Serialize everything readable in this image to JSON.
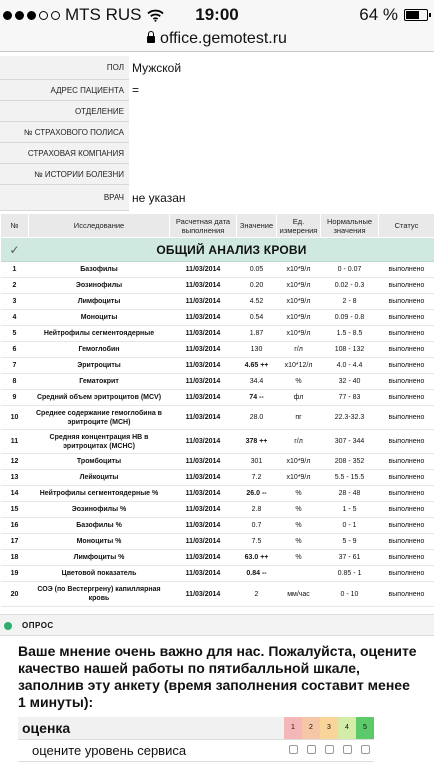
{
  "status_bar": {
    "carrier": "MTS RUS",
    "time": "19:00",
    "battery": "64 %",
    "battery_level": 0.64
  },
  "url_bar": {
    "domain": "office.gemotest.ru"
  },
  "patient": [
    {
      "label": "ПОЛ",
      "value": "Мужской"
    },
    {
      "label": "АДРЕС ПАЦИЕНТА",
      "value": "="
    },
    {
      "label": "ОТДЕЛЕНИЕ",
      "value": ""
    },
    {
      "label": "№ СТРАХОВОГО ПОЛИСА",
      "value": ""
    },
    {
      "label": "СТРАХОВАЯ КОМПАНИЯ",
      "value": ""
    },
    {
      "label": "№ ИСТОРИИ БОЛЕЗНИ",
      "value": ""
    },
    {
      "label": "ВРАЧ",
      "value": "не указан"
    }
  ],
  "table": {
    "headers": [
      "№",
      "Исследование",
      "Расчетная дата выполнения",
      "Значение",
      "Ед. измерения",
      "Нормальные значения",
      "Статус"
    ],
    "section_title": "ОБЩИЙ АНАЛИЗ КРОВИ",
    "section_check": "✓",
    "rows": [
      {
        "num": "1",
        "name": "Базофилы",
        "date": "11/03/2014",
        "value": "0.05",
        "unit": "x10*9/л",
        "norm": "0 - 0.07",
        "status": "выполнено",
        "flag": false
      },
      {
        "num": "2",
        "name": "Эозинофилы",
        "date": "11/03/2014",
        "value": "0.20",
        "unit": "x10*9/л",
        "norm": "0.02 - 0.3",
        "status": "выполнено",
        "flag": false
      },
      {
        "num": "3",
        "name": "Лимфоциты",
        "date": "11/03/2014",
        "value": "4.52",
        "unit": "x10*9/л",
        "norm": "2 - 8",
        "status": "выполнено",
        "flag": false
      },
      {
        "num": "4",
        "name": "Моноциты",
        "date": "11/03/2014",
        "value": "0.54",
        "unit": "x10*9/л",
        "norm": "0.09 - 0.8",
        "status": "выполнено",
        "flag": false
      },
      {
        "num": "5",
        "name": "Нейтрофилы сегментоядерные",
        "date": "11/03/2014",
        "value": "1.87",
        "unit": "x10*9/л",
        "norm": "1.5 - 8.5",
        "status": "выполнено",
        "flag": false
      },
      {
        "num": "6",
        "name": "Гемоглобин",
        "date": "11/03/2014",
        "value": "130",
        "unit": "г/л",
        "norm": "108 - 132",
        "status": "выполнено",
        "flag": false
      },
      {
        "num": "7",
        "name": "Эритроциты",
        "date": "11/03/2014",
        "value": "4.65 ++",
        "unit": "x10*12/л",
        "norm": "4.0 - 4.4",
        "status": "выполнено",
        "flag": true
      },
      {
        "num": "8",
        "name": "Гематокрит",
        "date": "11/03/2014",
        "value": "34.4",
        "unit": "%",
        "norm": "32 - 40",
        "status": "выполнено",
        "flag": false
      },
      {
        "num": "9",
        "name": "Средний объем эритроцитов (MCV)",
        "date": "11/03/2014",
        "value": "74 --",
        "unit": "фл",
        "norm": "77 - 83",
        "status": "выполнено",
        "flag": true
      },
      {
        "num": "10",
        "name": "Среднее содержание гемоглобина в эритроците (МСН)",
        "date": "11/03/2014",
        "value": "28.0",
        "unit": "пг",
        "norm": "22.3-32.3",
        "status": "выполнено",
        "flag": false
      },
      {
        "num": "11",
        "name": "Средняя концентрация НВ в эритроцитах (МСНС)",
        "date": "11/03/2014",
        "value": "378 ++",
        "unit": "г/л",
        "norm": "307 - 344",
        "status": "выполнено",
        "flag": true
      },
      {
        "num": "12",
        "name": "Тромбоциты",
        "date": "11/03/2014",
        "value": "301",
        "unit": "x10*9/л",
        "norm": "208 - 352",
        "status": "выполнено",
        "flag": false
      },
      {
        "num": "13",
        "name": "Лейкоциты",
        "date": "11/03/2014",
        "value": "7.2",
        "unit": "x10*9/л",
        "norm": "5.5 - 15.5",
        "status": "выполнено",
        "flag": false
      },
      {
        "num": "14",
        "name": "Нейтрофилы сегментоядерные %",
        "date": "11/03/2014",
        "value": "26.0 --",
        "unit": "%",
        "norm": "28 - 48",
        "status": "выполнено",
        "flag": true
      },
      {
        "num": "15",
        "name": "Эозинофилы %",
        "date": "11/03/2014",
        "value": "2.8",
        "unit": "%",
        "norm": "1 - 5",
        "status": "выполнено",
        "flag": false
      },
      {
        "num": "16",
        "name": "Базофилы %",
        "date": "11/03/2014",
        "value": "0.7",
        "unit": "%",
        "norm": "0 - 1",
        "status": "выполнено",
        "flag": false
      },
      {
        "num": "17",
        "name": "Моноциты %",
        "date": "11/03/2014",
        "value": "7.5",
        "unit": "%",
        "norm": "5 - 9",
        "status": "выполнено",
        "flag": false
      },
      {
        "num": "18",
        "name": "Лимфоциты %",
        "date": "11/03/2014",
        "value": "63.0 ++",
        "unit": "%",
        "norm": "37 - 61",
        "status": "выполнено",
        "flag": true
      },
      {
        "num": "19",
        "name": "Цветовой показатель",
        "date": "11/03/2014",
        "value": "0.84 --",
        "unit": "",
        "norm": "0.85 - 1",
        "status": "выполнено",
        "flag": true
      },
      {
        "num": "20",
        "name": "СОЭ (по Вестергрену) капиллярная кровь",
        "date": "11/03/2014",
        "value": "2",
        "unit": "мм/час",
        "norm": "0 - 10",
        "status": "выполнено",
        "flag": false
      }
    ]
  },
  "survey": {
    "section_label": "ОПРОС",
    "text": "Ваше мнение очень важно для нас. Пожалуйста, оцените качество нашей работы по пятибалльной шкале, заполнив эту анкету (время заполнения составит менее 1 минуты):",
    "grade_title": "оценка",
    "grades": [
      "1",
      "2",
      "3",
      "4",
      "5"
    ],
    "grade_colors": [
      "#f4b6b6",
      "#f6c7a6",
      "#f9d59a",
      "#d5eca8",
      "#5cc96a"
    ],
    "row_label": "оцените уровень сервиса"
  }
}
